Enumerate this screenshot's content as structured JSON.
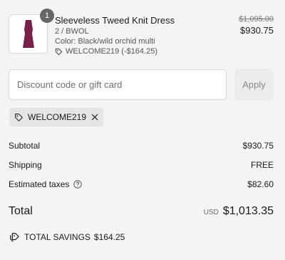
{
  "product": {
    "quantity": "1",
    "title": "Sleeveless Tweed Knit Dress",
    "variant": "2 / BWOL",
    "color": "Color: Black/wild orchid multi",
    "discount": "WELCOME219 (-$164.25)",
    "original_price": "$1,095.00",
    "price": "$930.75",
    "image_icon": "dress-thumbnail",
    "dress_color": "#7a1e4a"
  },
  "discount_form": {
    "placeholder": "Discount code or gift card",
    "apply_label": "Apply"
  },
  "applied_code": {
    "label": "WELCOME219",
    "icon": "tag-icon",
    "remove_icon": "close-icon"
  },
  "summary": {
    "subtotal_label": "Subtotal",
    "subtotal_value": "$930.75",
    "shipping_label": "Shipping",
    "shipping_value": "FREE",
    "taxes_label": "Estimated taxes",
    "taxes_value": "$82.60",
    "total_label": "Total",
    "total_currency": "USD",
    "total_value": "$1,013.35",
    "savings_label": "TOTAL SAVINGS",
    "savings_value": "$164.25"
  }
}
